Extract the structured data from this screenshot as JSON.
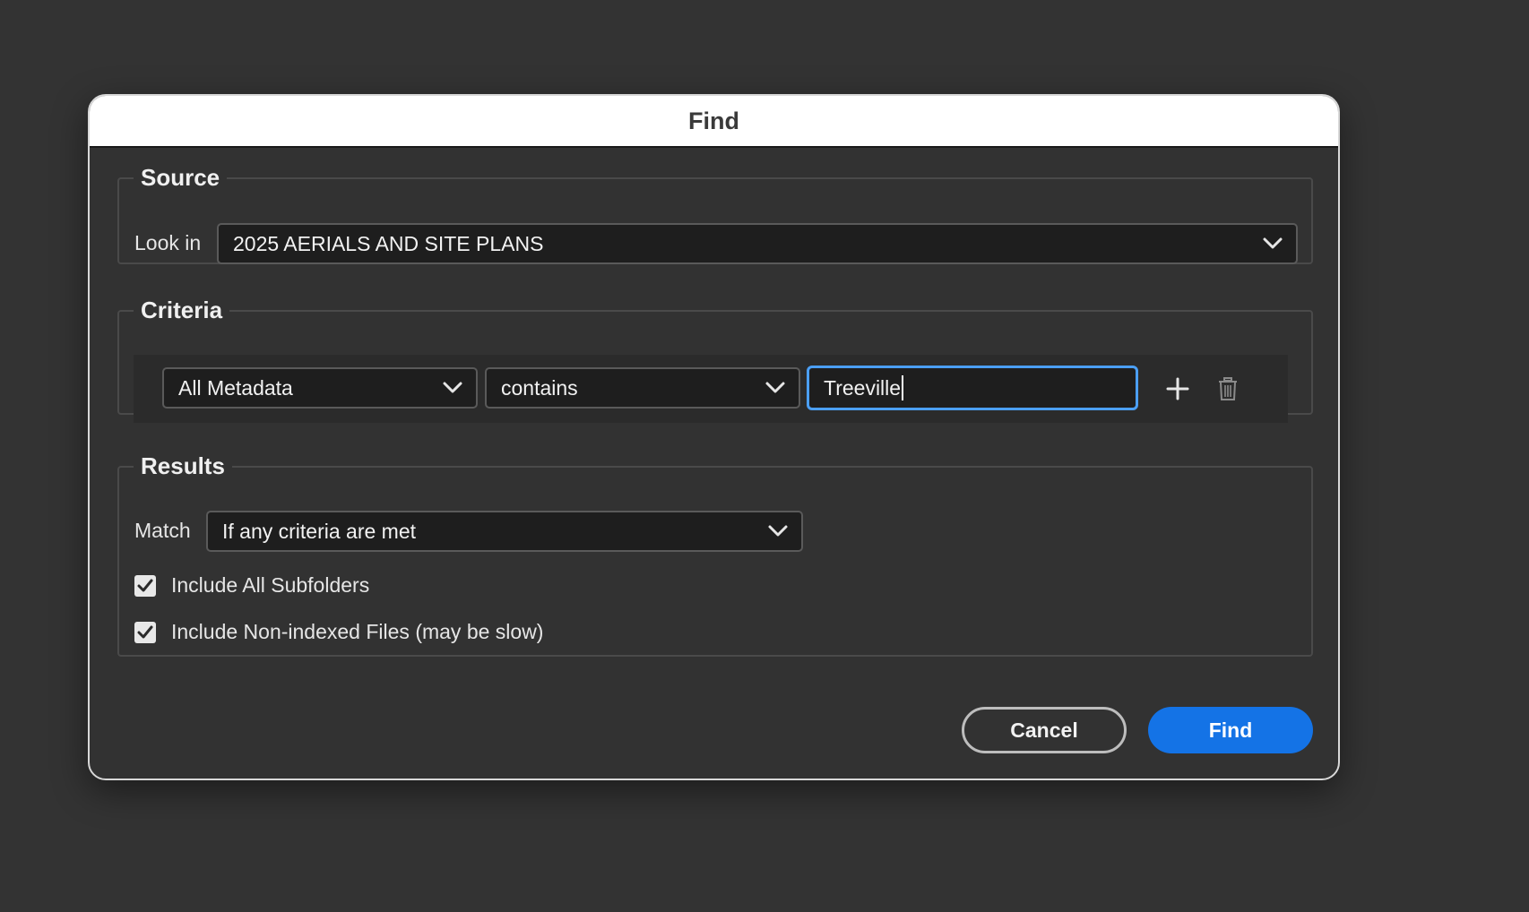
{
  "dialog": {
    "title": "Find"
  },
  "source": {
    "legend": "Source",
    "look_in_label": "Look in",
    "look_in_value": "2025 AERIALS AND SITE PLANS"
  },
  "criteria": {
    "legend": "Criteria",
    "field_value": "All Metadata",
    "operator_value": "contains",
    "search_text": "Treeville",
    "add_icon": "plus-icon",
    "remove_icon": "trash-icon"
  },
  "results": {
    "legend": "Results",
    "match_label": "Match",
    "match_value": "If any criteria are met",
    "checkboxes": [
      {
        "label": "Include All Subfolders",
        "checked": true
      },
      {
        "label": "Include Non-indexed Files (may be slow)",
        "checked": true
      }
    ]
  },
  "buttons": {
    "cancel_label": "Cancel",
    "find_label": "Find"
  },
  "colors": {
    "accent": "#1473e6",
    "focus_ring": "#4b9ff5",
    "background": "#333333"
  }
}
